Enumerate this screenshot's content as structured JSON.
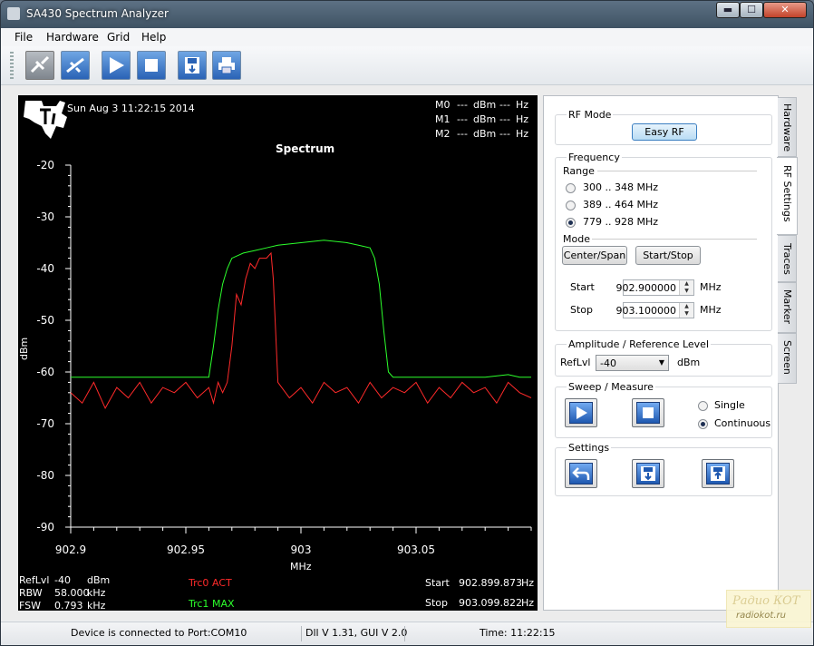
{
  "window": {
    "title": "SA430 Spectrum Analyzer",
    "min_label": "▬",
    "max_label": "☐",
    "close_label": "✕"
  },
  "menu": [
    "File",
    "Hardware",
    "Grid",
    "Help"
  ],
  "toolbar": {
    "buttons": [
      {
        "icon": "disconnect-icon"
      },
      {
        "icon": "connect-icon"
      },
      {
        "icon": "play-icon"
      },
      {
        "icon": "stop-icon"
      },
      {
        "icon": "save-icon"
      },
      {
        "icon": "print-icon"
      }
    ]
  },
  "plot": {
    "timestamp": "Sun Aug 3 11:22:15 2014",
    "title": "Spectrum",
    "markers": [
      {
        "name": "M0",
        "dbm": "---",
        "dbm_unit": "dBm",
        "hz": "---",
        "hz_unit": "Hz"
      },
      {
        "name": "M1",
        "dbm": "---",
        "dbm_unit": "dBm",
        "hz": "---",
        "hz_unit": "Hz"
      },
      {
        "name": "M2",
        "dbm": "---",
        "dbm_unit": "dBm",
        "hz": "---",
        "hz_unit": "Hz"
      }
    ],
    "ylabel": "dBm",
    "xlabel": "MHz",
    "y_ticks": [
      "-20",
      "-30",
      "-40",
      "-50",
      "-60",
      "-70",
      "-80",
      "-90"
    ],
    "x_ticks": [
      "902.9",
      "902.95",
      "903",
      "903.05"
    ],
    "bottom": {
      "reflvl_label": "RefLvl",
      "reflvl_value": "-40",
      "reflvl_unit": "dBm",
      "rbw_label": "RBW",
      "rbw_value": "58.000",
      "rbw_unit": "kHz",
      "fsw_label": "FSW",
      "fsw_value": "0.793",
      "fsw_unit": "kHz",
      "trc0_label": "Trc0",
      "trc0_mode": "ACT",
      "trc1_label": "Trc1",
      "trc1_mode": "MAX",
      "start_label": "Start",
      "start_value": "902.899.873",
      "start_unit": "Hz",
      "stop_label": "Stop",
      "stop_value": "903.099.822",
      "stop_unit": "Hz"
    },
    "colors": {
      "trc0": "#ff2a2a",
      "trc1": "#2cff2c",
      "grid": "#ffffff"
    }
  },
  "chart_data": {
    "type": "line",
    "title": "Spectrum",
    "xlabel": "MHz",
    "ylabel": "dBm",
    "xlim": [
      902.9,
      903.1
    ],
    "ylim": [
      -90,
      -20
    ],
    "x_ticks": [
      902.9,
      902.95,
      903,
      903.05
    ],
    "y_ticks": [
      -20,
      -30,
      -40,
      -50,
      -60,
      -70,
      -80,
      -90
    ],
    "grid": false,
    "series": [
      {
        "name": "Trc0",
        "x": [
          902.9,
          902.905,
          902.91,
          902.915,
          902.92,
          902.925,
          902.93,
          902.935,
          902.94,
          902.945,
          902.95,
          902.955,
          902.96,
          902.962,
          902.964,
          902.966,
          902.968,
          902.97,
          902.972,
          902.974,
          902.976,
          902.978,
          902.98,
          902.982,
          902.984,
          902.985,
          902.987,
          902.988,
          902.99,
          902.995,
          903.0,
          903.005,
          903.01,
          903.015,
          903.02,
          903.025,
          903.03,
          903.035,
          903.04,
          903.045,
          903.05,
          903.055,
          903.06,
          903.065,
          903.07,
          903.075,
          903.08,
          903.085,
          903.09,
          903.095,
          903.1
        ],
        "values": [
          -64,
          -66,
          -62,
          -67,
          -63,
          -65,
          -62,
          -66,
          -63,
          -64,
          -62,
          -65,
          -63,
          -66,
          -62,
          -64,
          -62,
          -55,
          -45,
          -47,
          -42,
          -39,
          -40,
          -38,
          -38,
          -38,
          -37,
          -42,
          -62,
          -65,
          -63,
          -66,
          -62,
          -64,
          -63,
          -66,
          -62,
          -65,
          -63,
          -64,
          -62,
          -66,
          -63,
          -65,
          -62,
          -64,
          -63,
          -66,
          -62,
          -64,
          -65
        ]
      },
      {
        "name": "Trc1",
        "x": [
          902.9,
          902.91,
          902.92,
          902.93,
          902.94,
          902.95,
          902.955,
          902.96,
          902.962,
          902.964,
          902.966,
          902.968,
          902.97,
          902.975,
          902.98,
          902.985,
          902.99,
          903.0,
          903.01,
          903.02,
          903.025,
          903.03,
          903.032,
          903.034,
          903.036,
          903.038,
          903.04,
          903.05,
          903.06,
          903.07,
          903.08,
          903.09,
          903.095,
          903.1
        ],
        "values": [
          -61,
          -61,
          -61,
          -61,
          -61,
          -61,
          -61,
          -61,
          -55,
          -48,
          -43,
          -40,
          -38,
          -37,
          -36.5,
          -36,
          -35.5,
          -35,
          -34.5,
          -35,
          -35.5,
          -36,
          -38,
          -43,
          -52,
          -60,
          -61,
          -61,
          -61,
          -61,
          -61,
          -60.5,
          -61,
          -61
        ]
      }
    ]
  },
  "panel": {
    "rfmode": {
      "title": "RF Mode",
      "button": "Easy RF"
    },
    "frequency": {
      "title": "Frequency",
      "range_label": "Range",
      "ranges": [
        "300 .. 348 MHz",
        "389 .. 464 MHz",
        "779 .. 928 MHz"
      ],
      "selected_range": 2,
      "mode_label": "Mode",
      "center_span": "Center/Span",
      "start_stop": "Start/Stop",
      "start_label": "Start",
      "start_value": "902.900000",
      "stop_label": "Stop",
      "stop_value": "903.100000",
      "unit": "MHz"
    },
    "amplitude": {
      "title": "Amplitude / Reference Level",
      "reflvl_label": "RefLvl",
      "reflvl_value": "-40",
      "unit": "dBm"
    },
    "sweep": {
      "title": "Sweep / Measure",
      "single": "Single",
      "continuous": "Continuous"
    },
    "settings": {
      "title": "Settings"
    }
  },
  "tabs": [
    "Hardware",
    "RF Settings",
    "Traces",
    "Marker",
    "Screen"
  ],
  "selected_tab": "RF Settings",
  "status": {
    "connection": "Device is connected to Port:COM10",
    "version": "Dll V 1.31, GUI V 2.0",
    "time": "Time: 11:22:15"
  },
  "watermark": {
    "line1": "Радио КОТ",
    "line2": "radiokot.ru"
  }
}
